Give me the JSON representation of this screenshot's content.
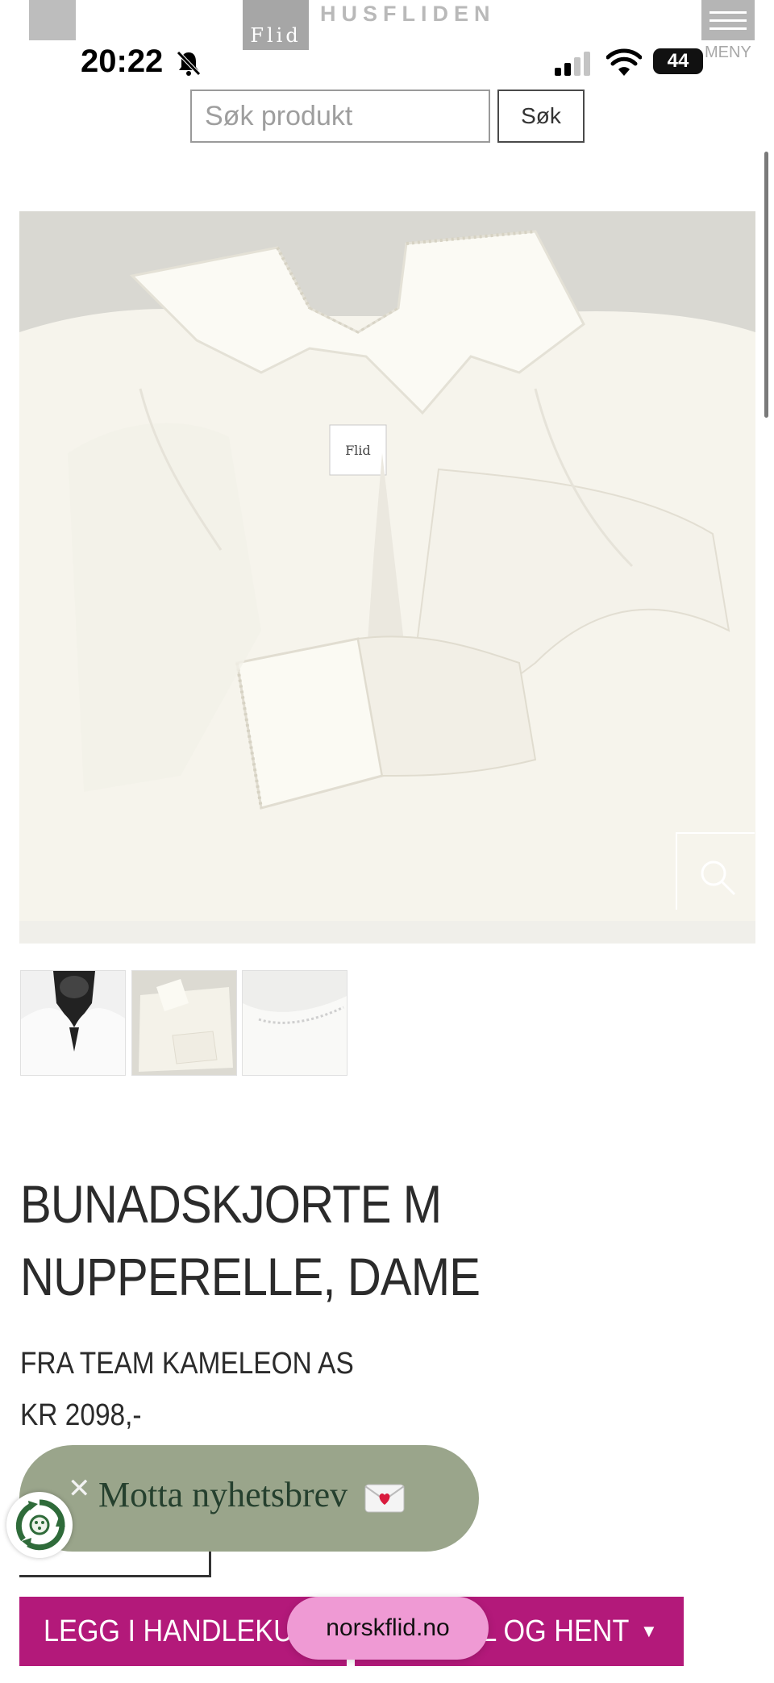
{
  "header": {
    "logo_mark": "Flid",
    "logo_text": "HUSFLIDEN",
    "menu_label": "MENY"
  },
  "status_bar": {
    "time": "20:22",
    "battery": "44"
  },
  "search": {
    "placeholder": "Søk produkt",
    "button_label": "Søk"
  },
  "gallery": {
    "main_image_alt": "white bunad shirt with lace collar",
    "thumbnails": [
      "thumbnail-1",
      "thumbnail-2",
      "thumbnail-3"
    ]
  },
  "product": {
    "title_line1": "BUNADSKJORTE M",
    "title_line2": "NUPPERELLE, DAME",
    "brand": "FRA TEAM KAMELEON AS",
    "price": "KR 2098,-"
  },
  "newsletter": {
    "label": "Motta nyhetsbrev"
  },
  "actions": {
    "add_to_cart": "LEGG I HANDLEKURV",
    "click_collect": "BESTILL OG HENT"
  },
  "browser": {
    "url": "norskflid.no"
  },
  "colors": {
    "accent": "#b3197a",
    "newsletter_bg": "#9aa58b",
    "url_pill": "#ef9ad4"
  }
}
